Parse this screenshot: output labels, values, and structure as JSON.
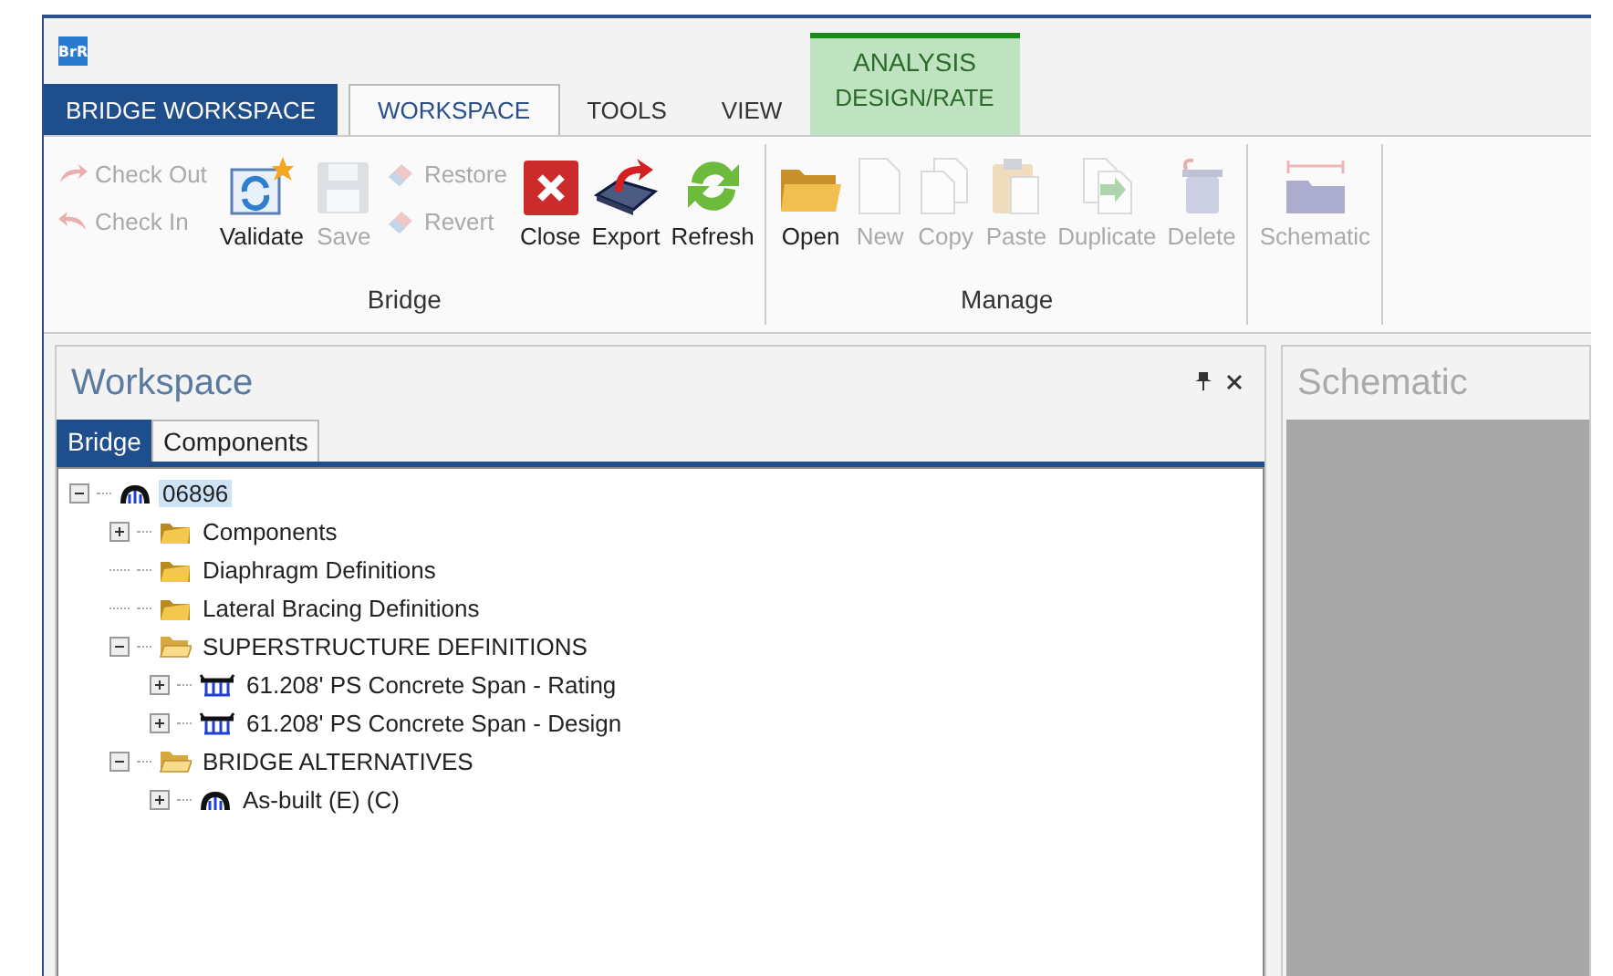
{
  "app_icon": {
    "label": "BrR"
  },
  "ribbon_tabs": [
    {
      "label": "BRIDGE WORKSPACE",
      "kind": "app"
    },
    {
      "label": "WORKSPACE",
      "kind": "normal",
      "selected": true
    },
    {
      "label": "TOOLS",
      "kind": "normal",
      "selected": false
    },
    {
      "label": "VIEW",
      "kind": "normal",
      "selected": false
    },
    {
      "label": "DESIGN/RATE",
      "kind": "contextual",
      "group": "ANALYSIS",
      "selected": false
    }
  ],
  "ribbon_groups": [
    {
      "label": "Bridge",
      "items": [
        {
          "kind": "stack",
          "buttons": [
            {
              "label": "Check Out",
              "disabled": true
            },
            {
              "label": "Check In",
              "disabled": true
            }
          ]
        },
        {
          "kind": "large",
          "label": "Validate",
          "disabled": false
        },
        {
          "kind": "large",
          "label": "Save",
          "disabled": true
        },
        {
          "kind": "stack",
          "buttons": [
            {
              "label": "Restore",
              "disabled": true
            },
            {
              "label": "Revert",
              "disabled": true
            }
          ]
        },
        {
          "kind": "large",
          "label": "Close",
          "disabled": false
        },
        {
          "kind": "large",
          "label": "Export",
          "disabled": false
        },
        {
          "kind": "large",
          "label": "Refresh",
          "disabled": false
        }
      ]
    },
    {
      "label": "Manage",
      "items": [
        {
          "kind": "large",
          "label": "Open",
          "disabled": false
        },
        {
          "kind": "large",
          "label": "New",
          "disabled": true
        },
        {
          "kind": "large",
          "label": "Copy",
          "disabled": true
        },
        {
          "kind": "large",
          "label": "Paste",
          "disabled": true
        },
        {
          "kind": "large",
          "label": "Duplicate",
          "disabled": true
        },
        {
          "kind": "large",
          "label": "Delete",
          "disabled": true
        }
      ]
    },
    {
      "items": [
        {
          "kind": "large",
          "label": "Schematic",
          "disabled": true
        }
      ]
    }
  ],
  "workspace": {
    "title": "Workspace",
    "tabs": [
      {
        "label": "Bridge",
        "selected": true
      },
      {
        "label": "Components",
        "selected": false
      }
    ],
    "tree": [
      {
        "label": "06896",
        "kind": "bridge",
        "selected": true,
        "expanded": true,
        "children": [
          {
            "label": "Components",
            "kind": "folder",
            "selected": false,
            "expanded": false
          },
          {
            "label": "Diaphragm Definitions",
            "kind": "folder",
            "selected": false
          },
          {
            "label": "Lateral Bracing Definitions",
            "kind": "folder",
            "selected": false
          },
          {
            "label": "SUPERSTRUCTURE DEFINITIONS",
            "kind": "folder-open",
            "selected": false,
            "expanded": true,
            "children": [
              {
                "label": "61.208' PS Concrete Span - Rating",
                "kind": "span",
                "selected": false,
                "expanded": false
              },
              {
                "label": "61.208' PS Concrete Span - Design",
                "kind": "span",
                "selected": false,
                "expanded": false
              }
            ]
          },
          {
            "label": "BRIDGE ALTERNATIVES",
            "kind": "folder-open",
            "selected": false,
            "expanded": true,
            "children": [
              {
                "label": "As-built (E)  (C)",
                "kind": "bridge",
                "selected": false,
                "expanded": false
              }
            ]
          }
        ]
      }
    ]
  },
  "schematic": {
    "title": "Schematic"
  }
}
